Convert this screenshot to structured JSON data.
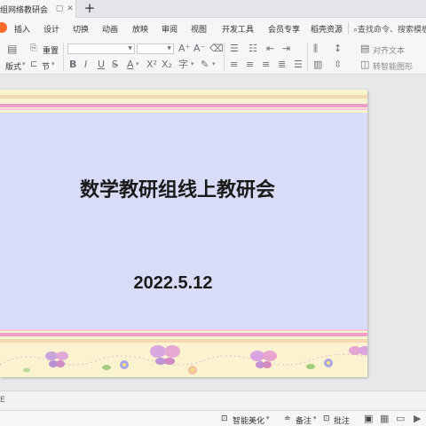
{
  "tab": {
    "title": "组网络教研会",
    "new_tab": "+"
  },
  "menu": {
    "items": [
      "插入",
      "设计",
      "切换",
      "动画",
      "放映",
      "审阅",
      "视图",
      "开发工具",
      "会员专享",
      "稻壳资源"
    ],
    "search": "查找命令、搜索模板"
  },
  "ribbon": {
    "reset_label": "重置",
    "layout_label": "版式",
    "section_label": "节",
    "align_text_label": "对齐文本",
    "smart_art_label": "转智能图形",
    "font_name_value": "",
    "font_size_value": ""
  },
  "slide": {
    "title": "数学教研组线上教研会",
    "date": "2022.5.12"
  },
  "notes": {
    "placeholder": "E"
  },
  "status": {
    "smart_beautify": "智能美化",
    "notes_label": "备注",
    "comments_label": "批注"
  }
}
